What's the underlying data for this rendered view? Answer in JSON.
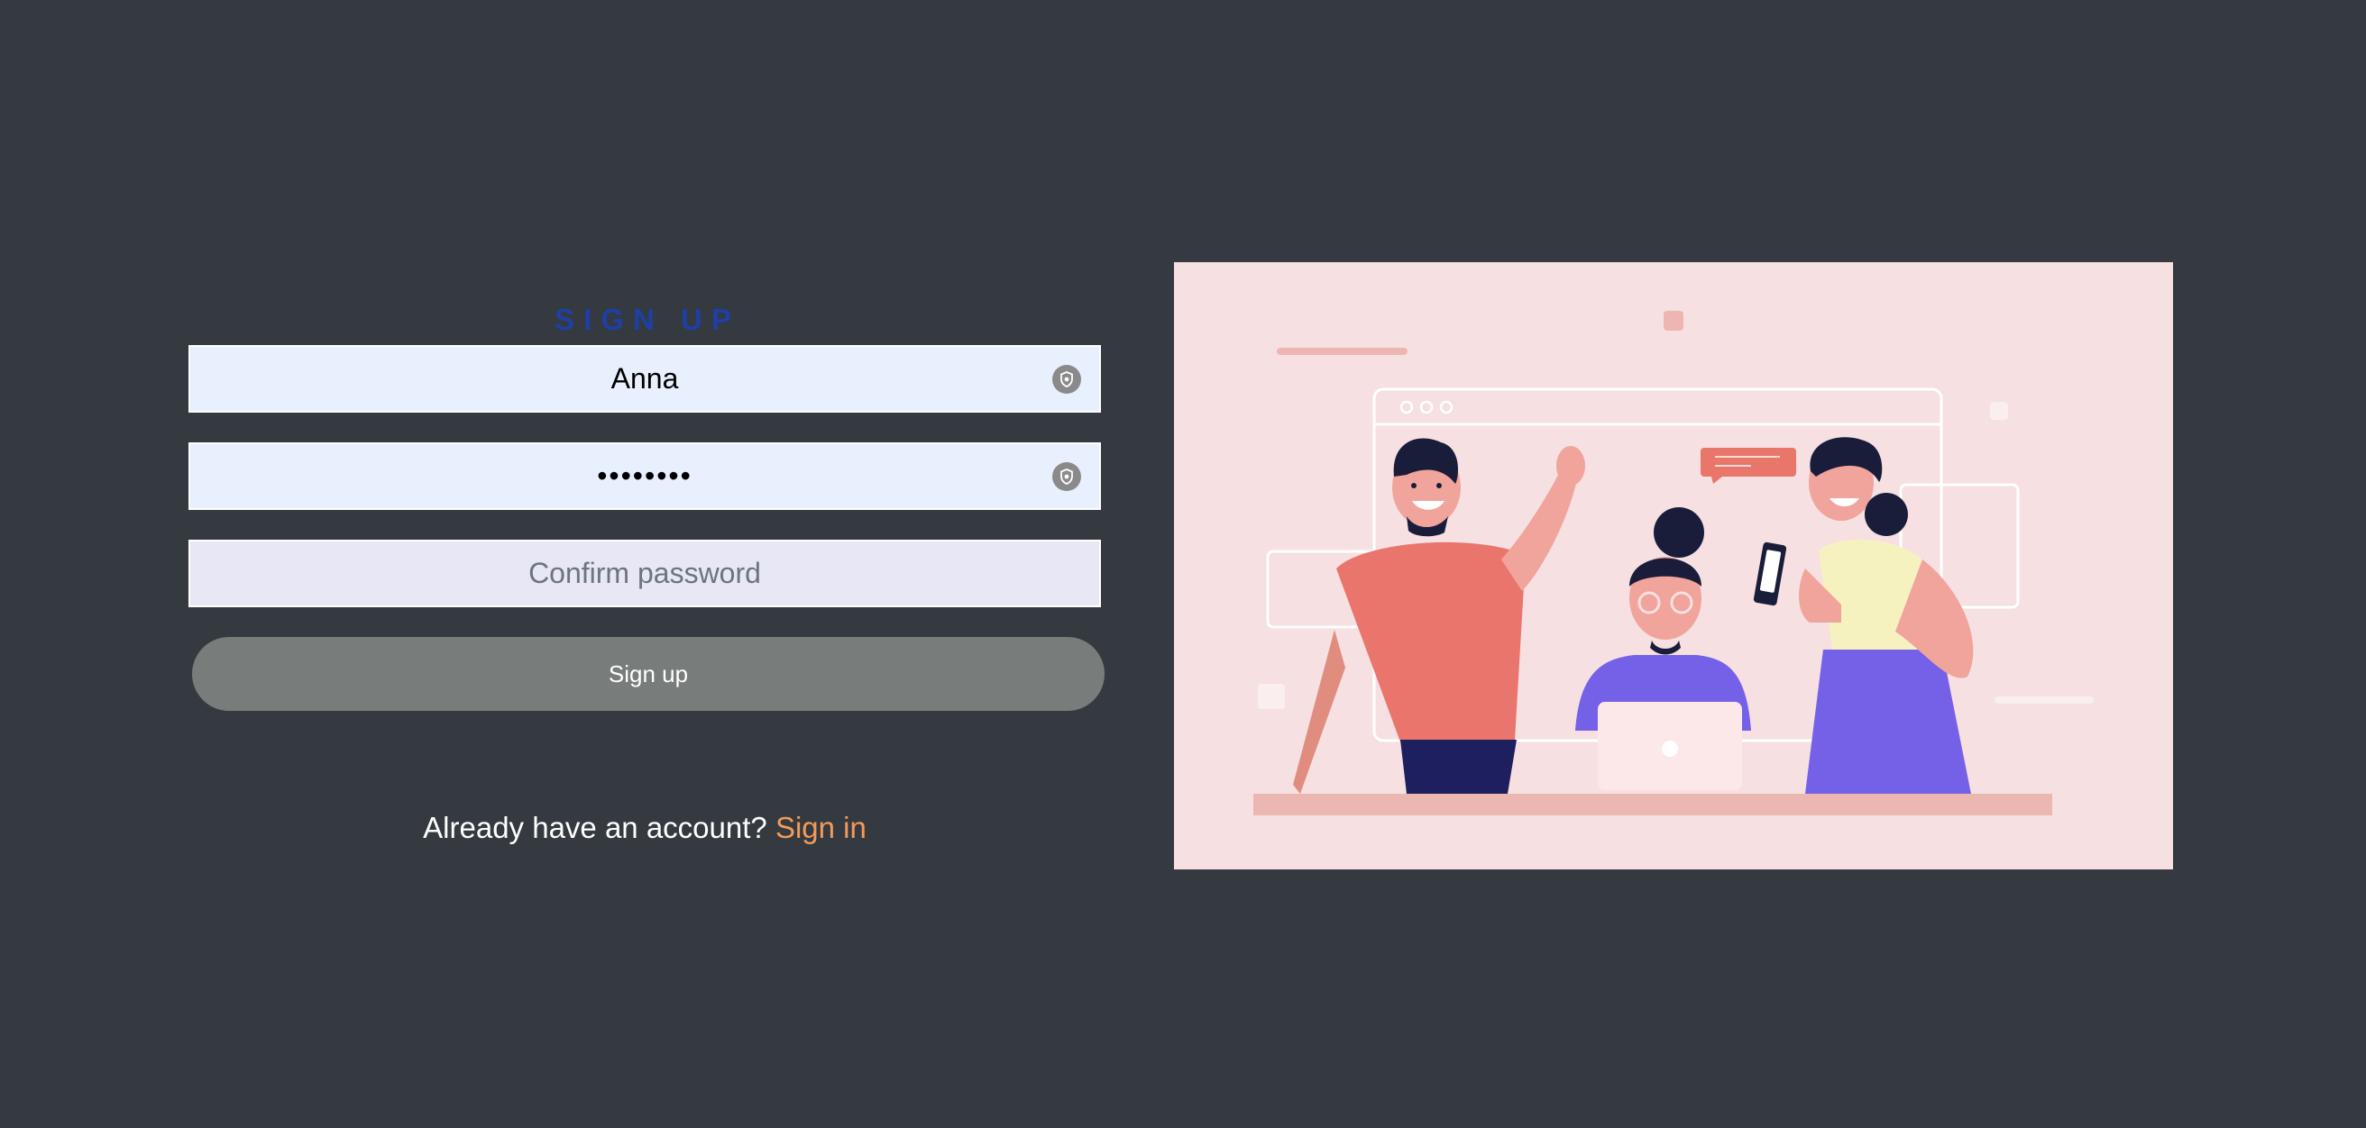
{
  "signup": {
    "title": "SIGN UP",
    "username_value": "Anna",
    "password_value": "••••••••",
    "confirm_placeholder": "Confirm password",
    "button_label": "Sign up"
  },
  "signin": {
    "prompt": "Already have an account?",
    "link_label": "Sign in"
  },
  "icons": {
    "field_icon": "password-manager-shield-icon"
  },
  "colors": {
    "background": "#343a40",
    "title": "#1e3fa6",
    "field_bg": "#e8f0fe",
    "button_bg": "#787d7c",
    "link": "#f39a5b",
    "illustration_bg": "#f6e0e1"
  }
}
